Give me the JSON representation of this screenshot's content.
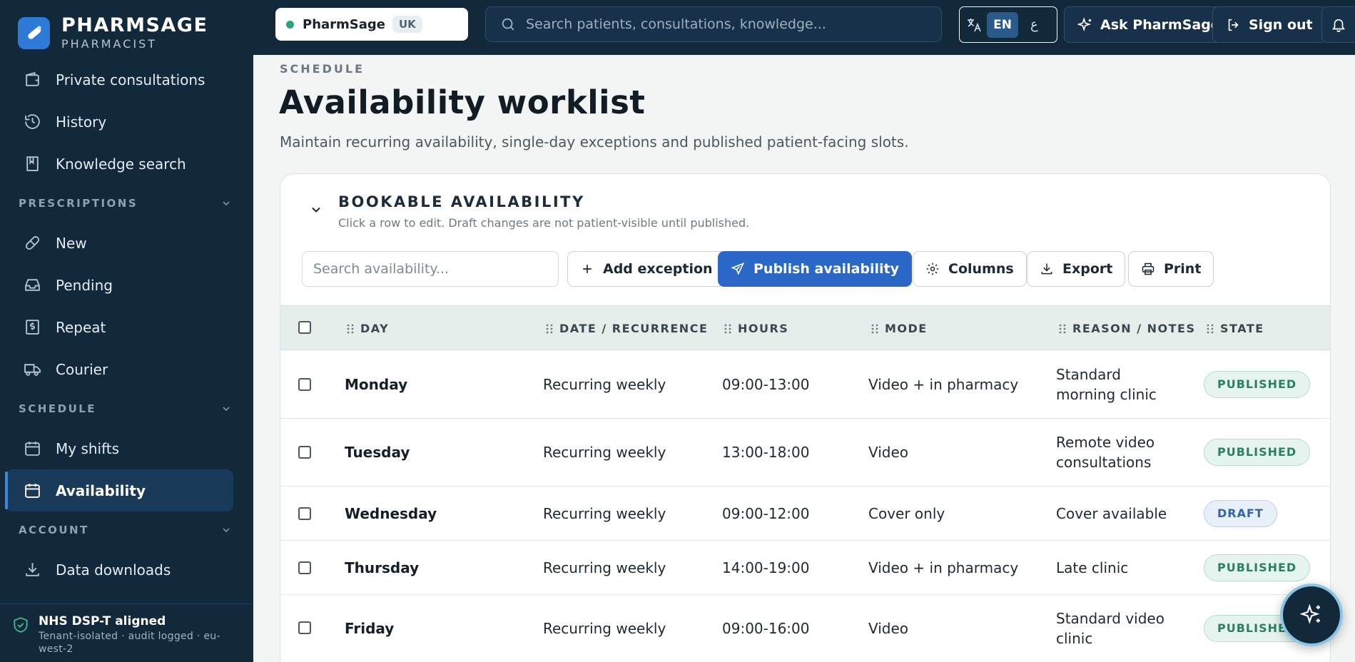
{
  "brand": {
    "name": "PHARMSAGE",
    "role": "PHARMACIST"
  },
  "sidebar": {
    "items_top": [
      {
        "label": "Private consultations",
        "icon": "wallet-icon"
      },
      {
        "label": "History",
        "icon": "history-icon"
      },
      {
        "label": "Knowledge search",
        "icon": "book-icon"
      }
    ],
    "sections": [
      {
        "title": "PRESCRIPTIONS",
        "items": [
          {
            "label": "New",
            "icon": "pill-icon"
          },
          {
            "label": "Pending",
            "icon": "inbox-icon"
          },
          {
            "label": "Repeat",
            "icon": "receipt-icon"
          },
          {
            "label": "Courier",
            "icon": "truck-icon"
          }
        ]
      },
      {
        "title": "SCHEDULE",
        "items": [
          {
            "label": "My shifts",
            "icon": "calendar-icon"
          },
          {
            "label": "Availability",
            "icon": "calendar-icon",
            "active": true
          }
        ]
      },
      {
        "title": "ACCOUNT",
        "items": [
          {
            "label": "Data downloads",
            "icon": "download-icon"
          }
        ]
      }
    ],
    "footer": {
      "title": "NHS DSP-T aligned",
      "subtitle": "Tenant-isolated · audit logged · eu-west-2"
    }
  },
  "topbar": {
    "tenant": {
      "name": "PharmSage",
      "region": "UK",
      "status_color": "#2aa37f"
    },
    "search_placeholder": "Search patients, consultations, knowledge...",
    "lang": {
      "active": "EN",
      "alt": "ع"
    },
    "ask_label": "Ask PharmSage",
    "signout_label": "Sign out"
  },
  "page": {
    "eyebrow": "SCHEDULE",
    "title": "Availability worklist",
    "subtitle": "Maintain recurring availability, single-day exceptions and published patient-facing slots."
  },
  "card": {
    "title": "BOOKABLE AVAILABILITY",
    "subtitle": "Click a row to edit. Draft changes are not patient-visible until published.",
    "search_placeholder": "Search availability...",
    "buttons": {
      "add": "Add exception",
      "publish": "Publish availability",
      "columns": "Columns",
      "export": "Export",
      "print": "Print"
    },
    "columns": [
      "DAY",
      "DATE / RECURRENCE",
      "HOURS",
      "MODE",
      "REASON / NOTES",
      "STATE"
    ],
    "rows": [
      {
        "day": "Monday",
        "recurrence": "Recurring weekly",
        "hours": "09:00-13:00",
        "mode": "Video + in pharmacy",
        "notes": "Standard morning clinic",
        "state": "PUBLISHED"
      },
      {
        "day": "Tuesday",
        "recurrence": "Recurring weekly",
        "hours": "13:00-18:00",
        "mode": "Video",
        "notes": "Remote video consultations",
        "state": "PUBLISHED"
      },
      {
        "day": "Wednesday",
        "recurrence": "Recurring weekly",
        "hours": "09:00-12:00",
        "mode": "Cover only",
        "notes": "Cover available",
        "state": "DRAFT"
      },
      {
        "day": "Thursday",
        "recurrence": "Recurring weekly",
        "hours": "14:00-19:00",
        "mode": "Video + in pharmacy",
        "notes": "Late clinic",
        "state": "PUBLISHED"
      },
      {
        "day": "Friday",
        "recurrence": "Recurring weekly",
        "hours": "09:00-16:00",
        "mode": "Video",
        "notes": "Standard video clinic",
        "state": "PUBLISHED"
      }
    ]
  },
  "colors": {
    "sidebar": "#12283b",
    "accent": "#2b67c6",
    "published": "#2c7f64",
    "draft": "#3563a6"
  }
}
